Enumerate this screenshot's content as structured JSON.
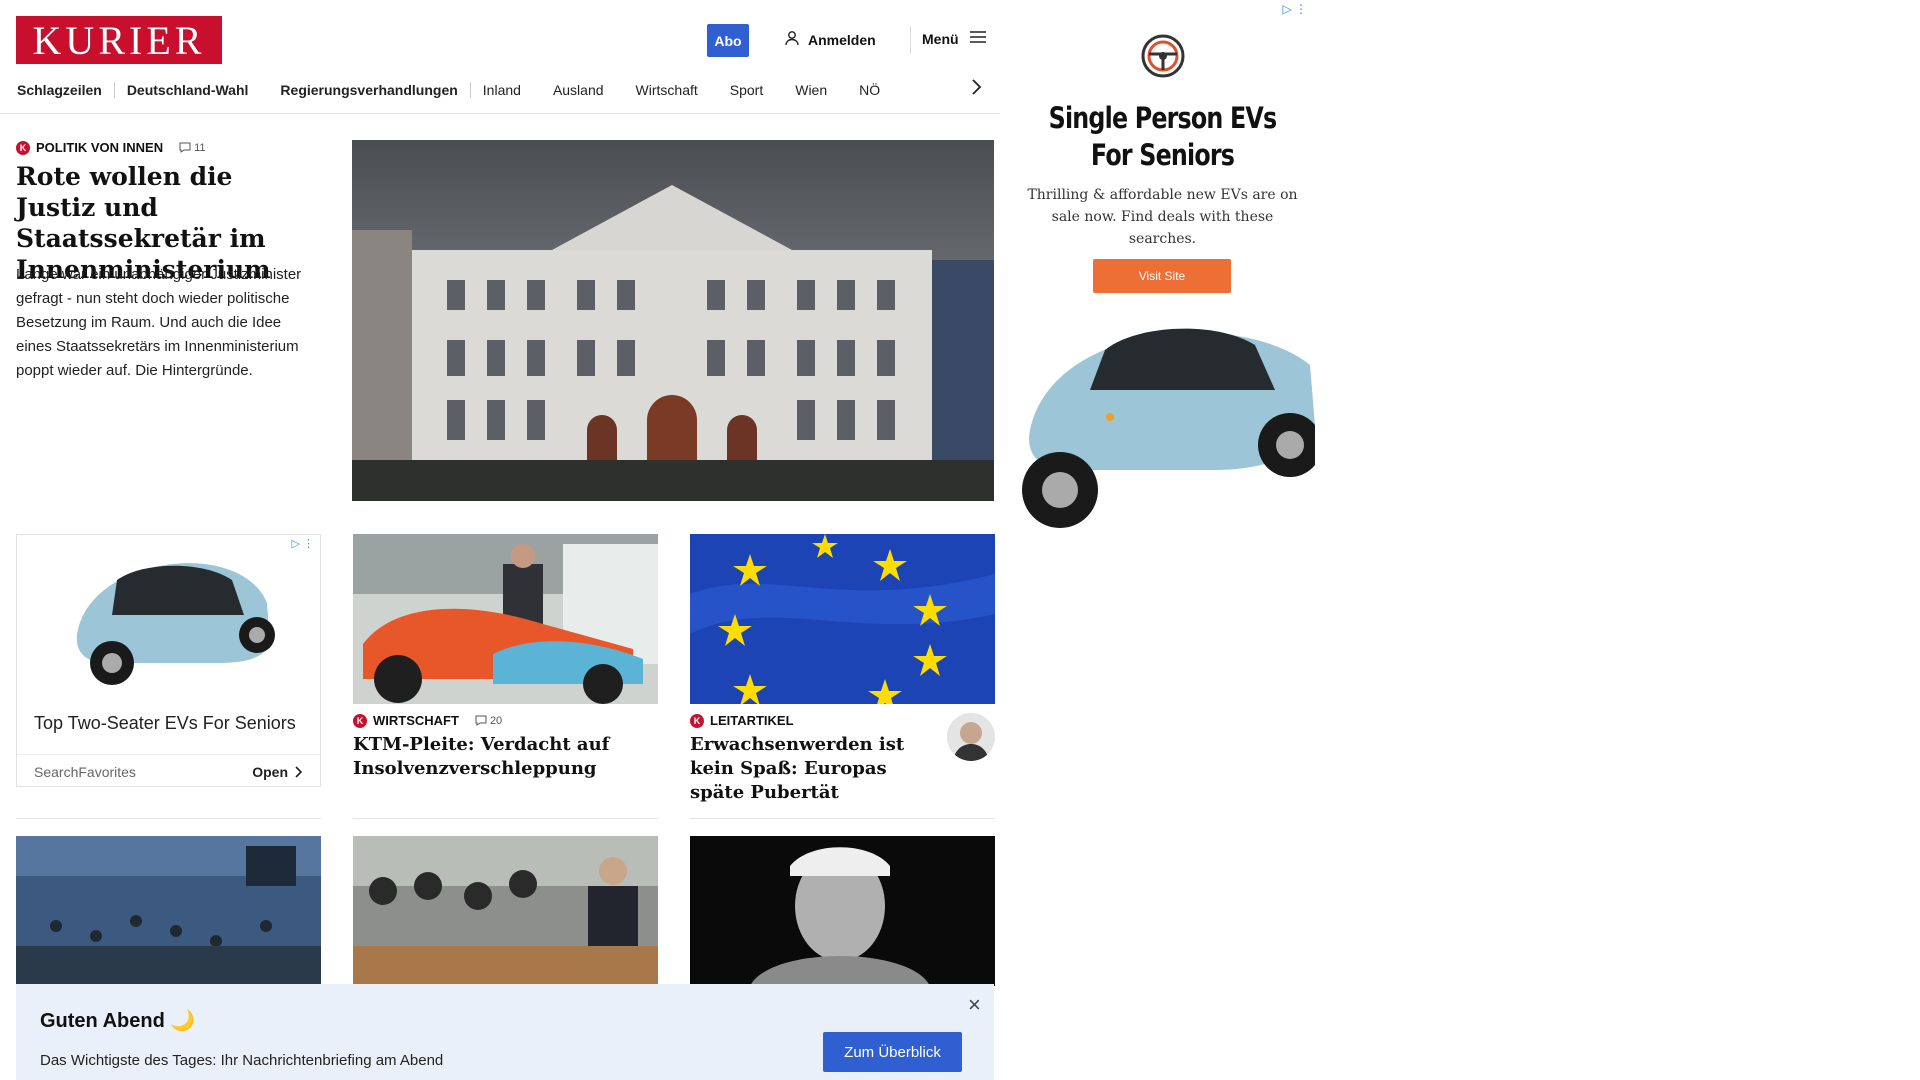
{
  "header": {
    "logo_text": "KURIER",
    "abo_label": "Abo",
    "login_label": "Anmelden",
    "menu_label": "Menü"
  },
  "nav": {
    "items": [
      "Schlagzeilen",
      "Deutschland-Wahl",
      "Regierungsverhandlungen",
      "Inland",
      "Ausland",
      "Wirtschaft",
      "Sport",
      "Wien",
      "NÖ"
    ]
  },
  "lead": {
    "kicker": "POLITIK VON INNEN",
    "comments": "11",
    "title": "Rote wollen die Justiz und Staatssekretär im Innenministerium",
    "text": "Lange war ein unabhängiger Justizminister gefragt - nun steht doch wieder politische Besetzung im Raum. Und auch die Idee eines Staatssekretärs im Innenministerium poppt wieder auf. Die Hintergründe."
  },
  "ad_right": {
    "title": "Single Person EVs For Seniors",
    "description": "Thrilling & affordable new EVs are on sale now. Find deals with these searches.",
    "button": "Visit Site"
  },
  "ad_card": {
    "title": "Top Two-Seater EVs For Seniors",
    "source": "SearchFavorites",
    "open_label": "Open"
  },
  "cards": [
    {
      "kicker": "WIRTSCHAFT",
      "comments": "20",
      "title": "KTM-Pleite: Verdacht auf Insolvenzverschleppung"
    },
    {
      "kicker": "LEITARTIKEL",
      "title": "Erwachsenwerden ist kein Spaß: Europas späte Pubertät"
    }
  ],
  "banner": {
    "title": "Guten Abend 🌙",
    "text": "Das Wichtigste des Tages: Ihr Nachrichtenbriefing am Abend",
    "button": "Zum Überblick"
  },
  "colors": {
    "brand_red": "#c8102e",
    "accent_blue": "#2f5fd0",
    "ad_orange": "#ee6f35",
    "banner_bg": "#eaf0fa"
  }
}
